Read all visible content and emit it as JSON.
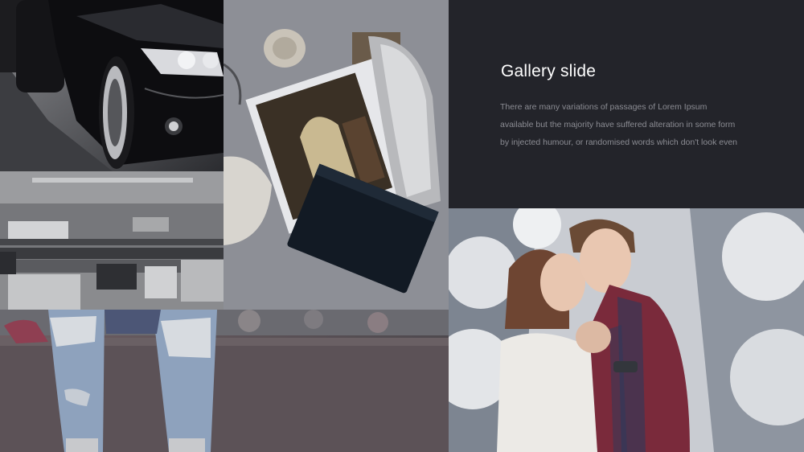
{
  "slide": {
    "title": "Gallery slide",
    "body_lines": [
      "There are many variations of passages of Lorem Ipsum",
      "available but the majority have suffered alteration in some form",
      "by injected humour, or randomised words which don't look even"
    ]
  },
  "theme": {
    "panel_background": "#23242a",
    "title_color": "#ffffff",
    "body_color": "#8b8c93"
  },
  "images": [
    "black-car-photo",
    "computer-classroom-photo",
    "magazine-photos-on-desk-photo",
    "ripped-jeans-photo",
    "couple-in-snow-photo"
  ]
}
